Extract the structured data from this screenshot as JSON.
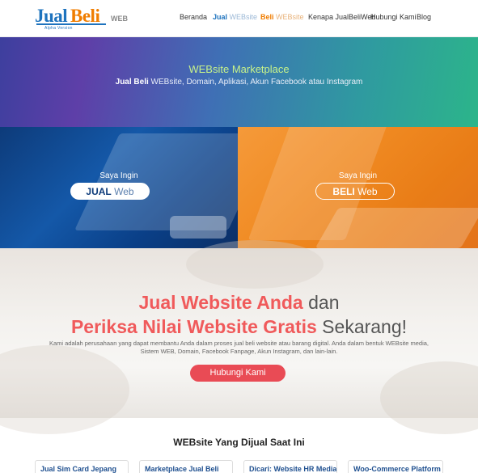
{
  "logo": {
    "jual": "Jual",
    "beli": "Beli",
    "web": "WEB",
    "tagline": "Alpha Version"
  },
  "nav": {
    "beranda": "Beranda",
    "jual_strong": "Jual",
    "jual_light": "WEBsite",
    "beli_strong": "Beli",
    "beli_light": "WEBsite",
    "kenapa": "Kenapa JualBeliWeb",
    "hubungi": "Hubungi Kami",
    "blog": "Blog"
  },
  "hero": {
    "title": "WEBsite Marketplace",
    "subtitle_strong": "Jual Beli",
    "subtitle_rest": " WEBsite, Domain, Aplikasi, Akun Facebook atau Instagram"
  },
  "panels": {
    "jual": {
      "title": "Saya Ingin",
      "button_strong": "JUAL",
      "button_light": " Web"
    },
    "beli": {
      "title": "Saya Ingin",
      "button_strong": "BELI",
      "button_light": " Web"
    }
  },
  "cta": {
    "line1_strong": "Jual Website Anda",
    "line1_rest": " dan",
    "line2_strong": "Periksa Nilai Website Gratis",
    "line2_rest": " Sekarang!",
    "description": "Kami adalah perusahaan yang dapat membantu Anda dalam proses jual beli website atau barang digital. Anda dalam bentuk WEBsite media, Sistem WEB, Domain, Facebook Fanpage, Akun Instagram, dan lain-lain.",
    "button": "Hubungi Kami"
  },
  "listings": {
    "heading": "WEBsite Yang Dijual Saat Ini",
    "cards": [
      "Jual Sim Card Jepang",
      "Marketplace Jual Beli",
      "Dicari: Website HR Media",
      "Woo-Commerce Platform"
    ]
  },
  "colors": {
    "brand_blue": "#1e73be",
    "brand_orange": "#f07d00",
    "cta_red": "#e94b55"
  }
}
